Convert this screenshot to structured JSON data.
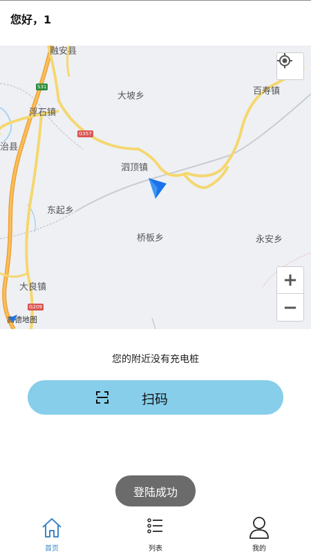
{
  "header": {
    "greeting": "您好，1"
  },
  "map": {
    "places": {
      "rongan": "融安县",
      "dapo": "大坡乡",
      "baishou": "百寿镇",
      "fushi": "浮石镇",
      "zhi": "治县",
      "sixding": "泗顶镇",
      "dongqi": "东起乡",
      "qiaoban": "桥板乡",
      "yongan": "永安乡",
      "daliang": "大良镇"
    },
    "shields": {
      "s31": "S31",
      "g357": "G357",
      "g209": "G209"
    },
    "logo_text": "高德地图",
    "zoom_in": "+",
    "zoom_out": "−",
    "colors": {
      "road": "#f5d76e",
      "highway": "#f0a030",
      "background": "#eef0f4",
      "arrow": "#1a73e8"
    }
  },
  "status": {
    "no_charger": "您的附近没有充电桩"
  },
  "scan": {
    "label": "扫码"
  },
  "toast": {
    "message": "登陆成功"
  },
  "tabs": [
    {
      "label": "首页",
      "icon": "home-icon",
      "active": true
    },
    {
      "label": "列表",
      "icon": "list-icon",
      "active": false
    },
    {
      "label": "我的",
      "icon": "user-icon",
      "active": false
    }
  ],
  "accent": "#3a86c8",
  "scan_button_color": "#87ceeb"
}
